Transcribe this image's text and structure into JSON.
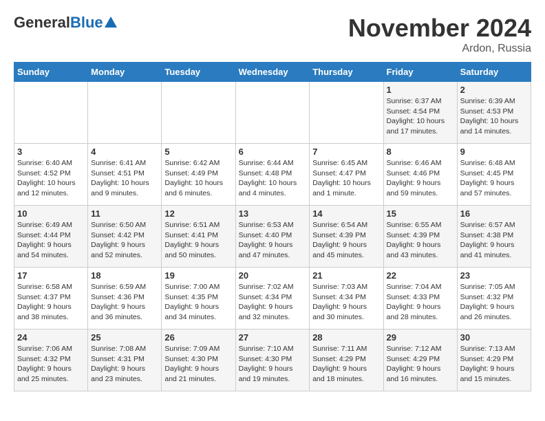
{
  "header": {
    "logo_general": "General",
    "logo_blue": "Blue",
    "month": "November 2024",
    "location": "Ardon, Russia"
  },
  "days_of_week": [
    "Sunday",
    "Monday",
    "Tuesday",
    "Wednesday",
    "Thursday",
    "Friday",
    "Saturday"
  ],
  "weeks": [
    [
      {
        "day": "",
        "info": ""
      },
      {
        "day": "",
        "info": ""
      },
      {
        "day": "",
        "info": ""
      },
      {
        "day": "",
        "info": ""
      },
      {
        "day": "",
        "info": ""
      },
      {
        "day": "1",
        "info": "Sunrise: 6:37 AM\nSunset: 4:54 PM\nDaylight: 10 hours and 17 minutes."
      },
      {
        "day": "2",
        "info": "Sunrise: 6:39 AM\nSunset: 4:53 PM\nDaylight: 10 hours and 14 minutes."
      }
    ],
    [
      {
        "day": "3",
        "info": "Sunrise: 6:40 AM\nSunset: 4:52 PM\nDaylight: 10 hours and 12 minutes."
      },
      {
        "day": "4",
        "info": "Sunrise: 6:41 AM\nSunset: 4:51 PM\nDaylight: 10 hours and 9 minutes."
      },
      {
        "day": "5",
        "info": "Sunrise: 6:42 AM\nSunset: 4:49 PM\nDaylight: 10 hours and 6 minutes."
      },
      {
        "day": "6",
        "info": "Sunrise: 6:44 AM\nSunset: 4:48 PM\nDaylight: 10 hours and 4 minutes."
      },
      {
        "day": "7",
        "info": "Sunrise: 6:45 AM\nSunset: 4:47 PM\nDaylight: 10 hours and 1 minute."
      },
      {
        "day": "8",
        "info": "Sunrise: 6:46 AM\nSunset: 4:46 PM\nDaylight: 9 hours and 59 minutes."
      },
      {
        "day": "9",
        "info": "Sunrise: 6:48 AM\nSunset: 4:45 PM\nDaylight: 9 hours and 57 minutes."
      }
    ],
    [
      {
        "day": "10",
        "info": "Sunrise: 6:49 AM\nSunset: 4:44 PM\nDaylight: 9 hours and 54 minutes."
      },
      {
        "day": "11",
        "info": "Sunrise: 6:50 AM\nSunset: 4:42 PM\nDaylight: 9 hours and 52 minutes."
      },
      {
        "day": "12",
        "info": "Sunrise: 6:51 AM\nSunset: 4:41 PM\nDaylight: 9 hours and 50 minutes."
      },
      {
        "day": "13",
        "info": "Sunrise: 6:53 AM\nSunset: 4:40 PM\nDaylight: 9 hours and 47 minutes."
      },
      {
        "day": "14",
        "info": "Sunrise: 6:54 AM\nSunset: 4:39 PM\nDaylight: 9 hours and 45 minutes."
      },
      {
        "day": "15",
        "info": "Sunrise: 6:55 AM\nSunset: 4:39 PM\nDaylight: 9 hours and 43 minutes."
      },
      {
        "day": "16",
        "info": "Sunrise: 6:57 AM\nSunset: 4:38 PM\nDaylight: 9 hours and 41 minutes."
      }
    ],
    [
      {
        "day": "17",
        "info": "Sunrise: 6:58 AM\nSunset: 4:37 PM\nDaylight: 9 hours and 38 minutes."
      },
      {
        "day": "18",
        "info": "Sunrise: 6:59 AM\nSunset: 4:36 PM\nDaylight: 9 hours and 36 minutes."
      },
      {
        "day": "19",
        "info": "Sunrise: 7:00 AM\nSunset: 4:35 PM\nDaylight: 9 hours and 34 minutes."
      },
      {
        "day": "20",
        "info": "Sunrise: 7:02 AM\nSunset: 4:34 PM\nDaylight: 9 hours and 32 minutes."
      },
      {
        "day": "21",
        "info": "Sunrise: 7:03 AM\nSunset: 4:34 PM\nDaylight: 9 hours and 30 minutes."
      },
      {
        "day": "22",
        "info": "Sunrise: 7:04 AM\nSunset: 4:33 PM\nDaylight: 9 hours and 28 minutes."
      },
      {
        "day": "23",
        "info": "Sunrise: 7:05 AM\nSunset: 4:32 PM\nDaylight: 9 hours and 26 minutes."
      }
    ],
    [
      {
        "day": "24",
        "info": "Sunrise: 7:06 AM\nSunset: 4:32 PM\nDaylight: 9 hours and 25 minutes."
      },
      {
        "day": "25",
        "info": "Sunrise: 7:08 AM\nSunset: 4:31 PM\nDaylight: 9 hours and 23 minutes."
      },
      {
        "day": "26",
        "info": "Sunrise: 7:09 AM\nSunset: 4:30 PM\nDaylight: 9 hours and 21 minutes."
      },
      {
        "day": "27",
        "info": "Sunrise: 7:10 AM\nSunset: 4:30 PM\nDaylight: 9 hours and 19 minutes."
      },
      {
        "day": "28",
        "info": "Sunrise: 7:11 AM\nSunset: 4:29 PM\nDaylight: 9 hours and 18 minutes."
      },
      {
        "day": "29",
        "info": "Sunrise: 7:12 AM\nSunset: 4:29 PM\nDaylight: 9 hours and 16 minutes."
      },
      {
        "day": "30",
        "info": "Sunrise: 7:13 AM\nSunset: 4:29 PM\nDaylight: 9 hours and 15 minutes."
      }
    ]
  ]
}
